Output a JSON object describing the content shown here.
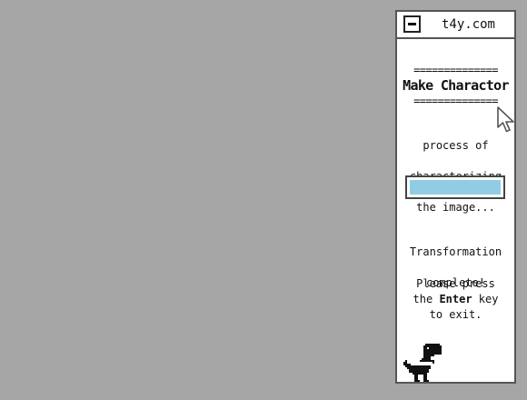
{
  "window": {
    "title": "t4y.com",
    "minimize_icon": "minimize-icon"
  },
  "header": {
    "rule_top": "==============",
    "heading": "Make Charactor",
    "rule_bottom": "=============="
  },
  "process": {
    "line1": "process of",
    "line2": "characterizing",
    "line3": "the image..."
  },
  "progress": {
    "value_percent": 100,
    "fill_color": "#90cde4"
  },
  "status": {
    "line1": "Transformation",
    "line2": "complete!"
  },
  "instructions": {
    "line1": "Please press",
    "pre_key": "the ",
    "key": "Enter",
    "post_key": " key",
    "line3": "to exit."
  },
  "icons": {
    "mascot": "dinosaur-icon",
    "pointer": "mouse-cursor-icon"
  }
}
